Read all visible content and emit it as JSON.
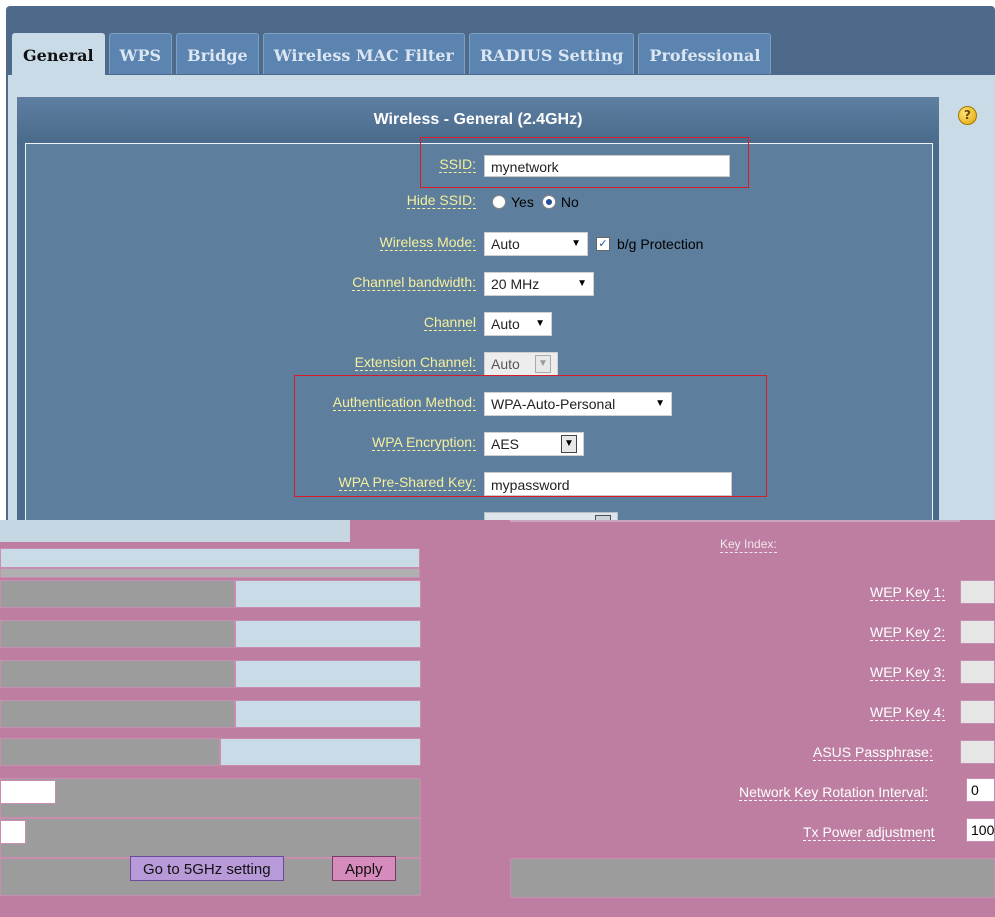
{
  "tabs": [
    "General",
    "WPS",
    "Bridge",
    "Wireless MAC Filter",
    "RADIUS Setting",
    "Professional"
  ],
  "help_icon": "?",
  "form_title": "Wireless - General (2.4GHz)",
  "fields": {
    "ssid": {
      "label": "SSID:",
      "value": "mynetwork"
    },
    "hide_ssid": {
      "label": "Hide SSID:",
      "yes": "Yes",
      "no": "No",
      "selected": "No"
    },
    "wireless_mode": {
      "label": "Wireless Mode:",
      "value": "Auto",
      "bg_protection": "b/g Protection",
      "bg_checked": true
    },
    "channel_bandwidth": {
      "label": "Channel bandwidth:",
      "value": "20 MHz"
    },
    "channel": {
      "label": "Channel",
      "value": "Auto"
    },
    "extension_channel": {
      "label": "Extension Channel:",
      "value": "Auto"
    },
    "auth_method": {
      "label": "Authentication Method:",
      "value": "WPA-Auto-Personal"
    },
    "wpa_encryption": {
      "label": "WPA Encryption:",
      "value": "AES"
    },
    "wpa_psk": {
      "label": "WPA Pre-Shared Key:",
      "value": "mypassword"
    }
  },
  "glitch": {
    "wep_keys": [
      "WEP Key 1:",
      "WEP Key 2:",
      "WEP Key 3:",
      "WEP Key 4:"
    ],
    "asus_passphrase": "ASUS Passphrase:",
    "key_rotation": {
      "label": "Network Key Rotation Interval:",
      "value": "0"
    },
    "tx_power": {
      "label": "Tx Power adjustment",
      "value": "100"
    },
    "key_index_fragment": "Key Index:"
  },
  "buttons": {
    "five_ghz": "Go to 5GHz setting",
    "apply": "Apply"
  },
  "colors": {
    "highlight": "#d81b2a",
    "label": "#f4ef9e",
    "panel": "#5d7e9c",
    "glitch": "#bd7ea2"
  }
}
